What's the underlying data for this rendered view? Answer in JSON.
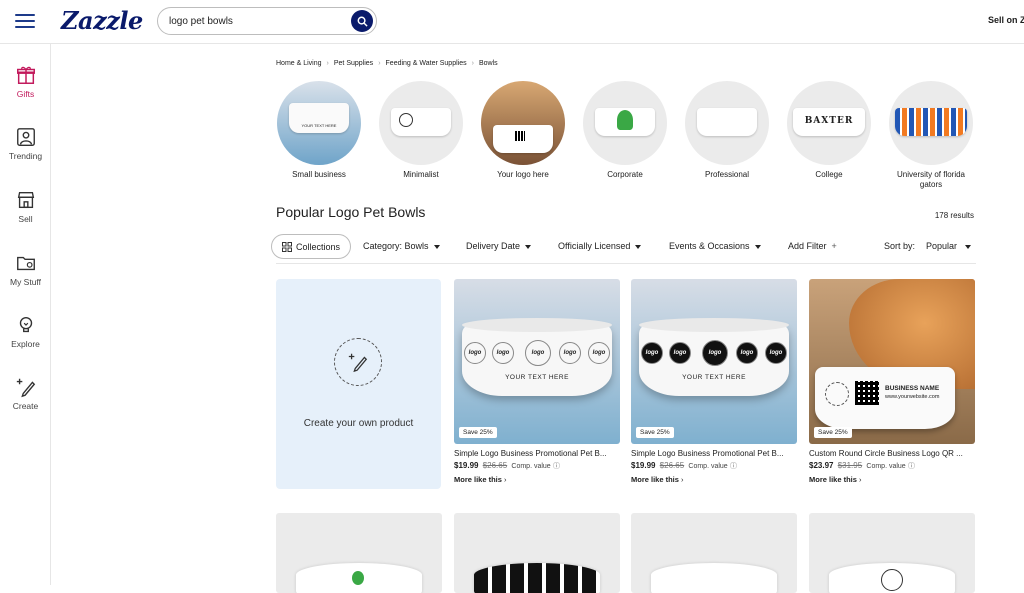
{
  "header": {
    "logo": "Zazzle",
    "search_value": "logo pet bowls",
    "sell_link": "Sell on Z"
  },
  "rail": [
    {
      "label": "Gifts",
      "icon": "gift-icon"
    },
    {
      "label": "Trending",
      "icon": "trending-icon"
    },
    {
      "label": "Sell",
      "icon": "store-icon"
    },
    {
      "label": "My Stuff",
      "icon": "folder-icon"
    },
    {
      "label": "Explore",
      "icon": "bulb-icon"
    },
    {
      "label": "Create",
      "icon": "sparkle-pen-icon"
    }
  ],
  "breadcrumb": [
    "Home & Living",
    "Pet Supplies",
    "Feeding & Water Supplies",
    "Bowls"
  ],
  "categories": [
    {
      "label": "Small business"
    },
    {
      "label": "Minimalist"
    },
    {
      "label": "Your logo here"
    },
    {
      "label": "Corporate"
    },
    {
      "label": "Professional"
    },
    {
      "label": "College"
    },
    {
      "label": "University of florida gators"
    }
  ],
  "page_title": "Popular Logo Pet Bowls",
  "results_count": "178 results",
  "filters": {
    "collections": "Collections",
    "category": "Category: Bowls",
    "delivery": "Delivery Date",
    "licensed": "Officially Licensed",
    "events": "Events & Occasions",
    "add_filter": "Add Filter",
    "sort_label": "Sort by:",
    "sort_value": "Popular"
  },
  "create_card": {
    "text": "Create your own product"
  },
  "products": [
    {
      "badge": "Save 25%",
      "name": "Simple Logo Business Promotional Pet B...",
      "price": "$19.99",
      "was": "$26.65",
      "comp": "Comp. value",
      "more": "More like this"
    },
    {
      "badge": "Save 25%",
      "name": "Simple Logo Business Promotional Pet B...",
      "price": "$19.99",
      "was": "$26.65",
      "comp": "Comp. value",
      "more": "More like this"
    },
    {
      "badge": "Save 25%",
      "name": "Custom Round Circle Business Logo QR ...",
      "price": "$23.97",
      "was": "$31.95",
      "comp": "Comp. value",
      "more": "More like this"
    }
  ],
  "bowl_print": {
    "your_text_here": "YOUR TEXT HERE",
    "logo": "logo",
    "baxter": "BAXTER",
    "business_name": "BUSINESS NAME",
    "website": "www.yourwebsite.com"
  },
  "colors": {
    "brand": "#0a1a6b",
    "accent": "#c2185b"
  }
}
